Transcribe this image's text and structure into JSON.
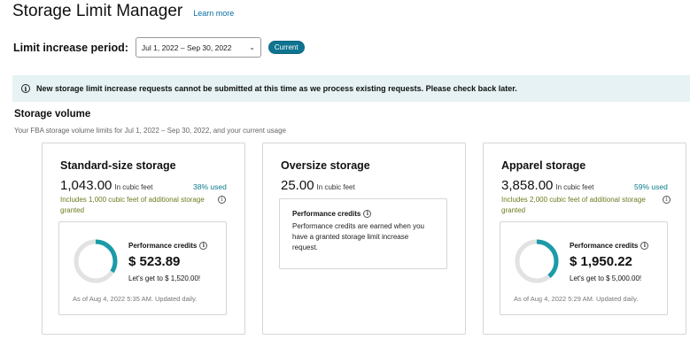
{
  "header": {
    "title": "Storage Limit Manager",
    "learn_more": "Learn more"
  },
  "period": {
    "label": "Limit increase period:",
    "selected": "Jul 1, 2022 – Sep 30, 2022",
    "badge": "Current"
  },
  "alert": {
    "icon": "info-icon",
    "text": "New storage limit increase requests cannot be submitted at this time as we process existing requests. Please check back later."
  },
  "storage_volume": {
    "title": "Storage volume",
    "subtitle": "Your FBA storage volume limits for Jul 1, 2022 – Sep 30, 2022, and your current usage"
  },
  "cards": {
    "standard": {
      "title": "Standard-size storage",
      "volume": "1,043.00",
      "unit": "In cubic feet",
      "used": "38% used",
      "used_fraction": 0.38,
      "granted": "Includes 1,000 cubic feet of additional storage granted",
      "perf_label": "Performance credits",
      "perf_value": "$ 523.89",
      "perf_goal": "Let's get to $ 1,520.00!",
      "perf_fraction": 0.34,
      "as_of": "As of Aug 4, 2022 5:35 AM. Updated daily."
    },
    "oversize": {
      "title": "Oversize storage",
      "volume": "25.00",
      "unit": "In cubic feet",
      "perf_label": "Performance credits",
      "perf_desc": "Performance credits are earned when you have a granted storage limit increase request."
    },
    "apparel": {
      "title": "Apparel storage",
      "volume": "3,858.00",
      "unit": "In cubic feet",
      "used": "59% used",
      "used_fraction": 0.59,
      "granted": "Includes 2,000 cubic feet of additional storage granted",
      "perf_label": "Performance credits",
      "perf_value": "$ 1,950.22",
      "perf_goal": "Let's get to $ 5,000.00!",
      "perf_fraction": 0.39,
      "as_of": "As of Aug 4, 2022 5:29 AM. Updated daily."
    }
  },
  "colors": {
    "accent": "#0e7490",
    "gauge_fill": "#1a9ba8",
    "gauge_track": "#e2e2e2",
    "granted_text": "#6b7c1f",
    "alert_bg": "#e6f2f3"
  }
}
